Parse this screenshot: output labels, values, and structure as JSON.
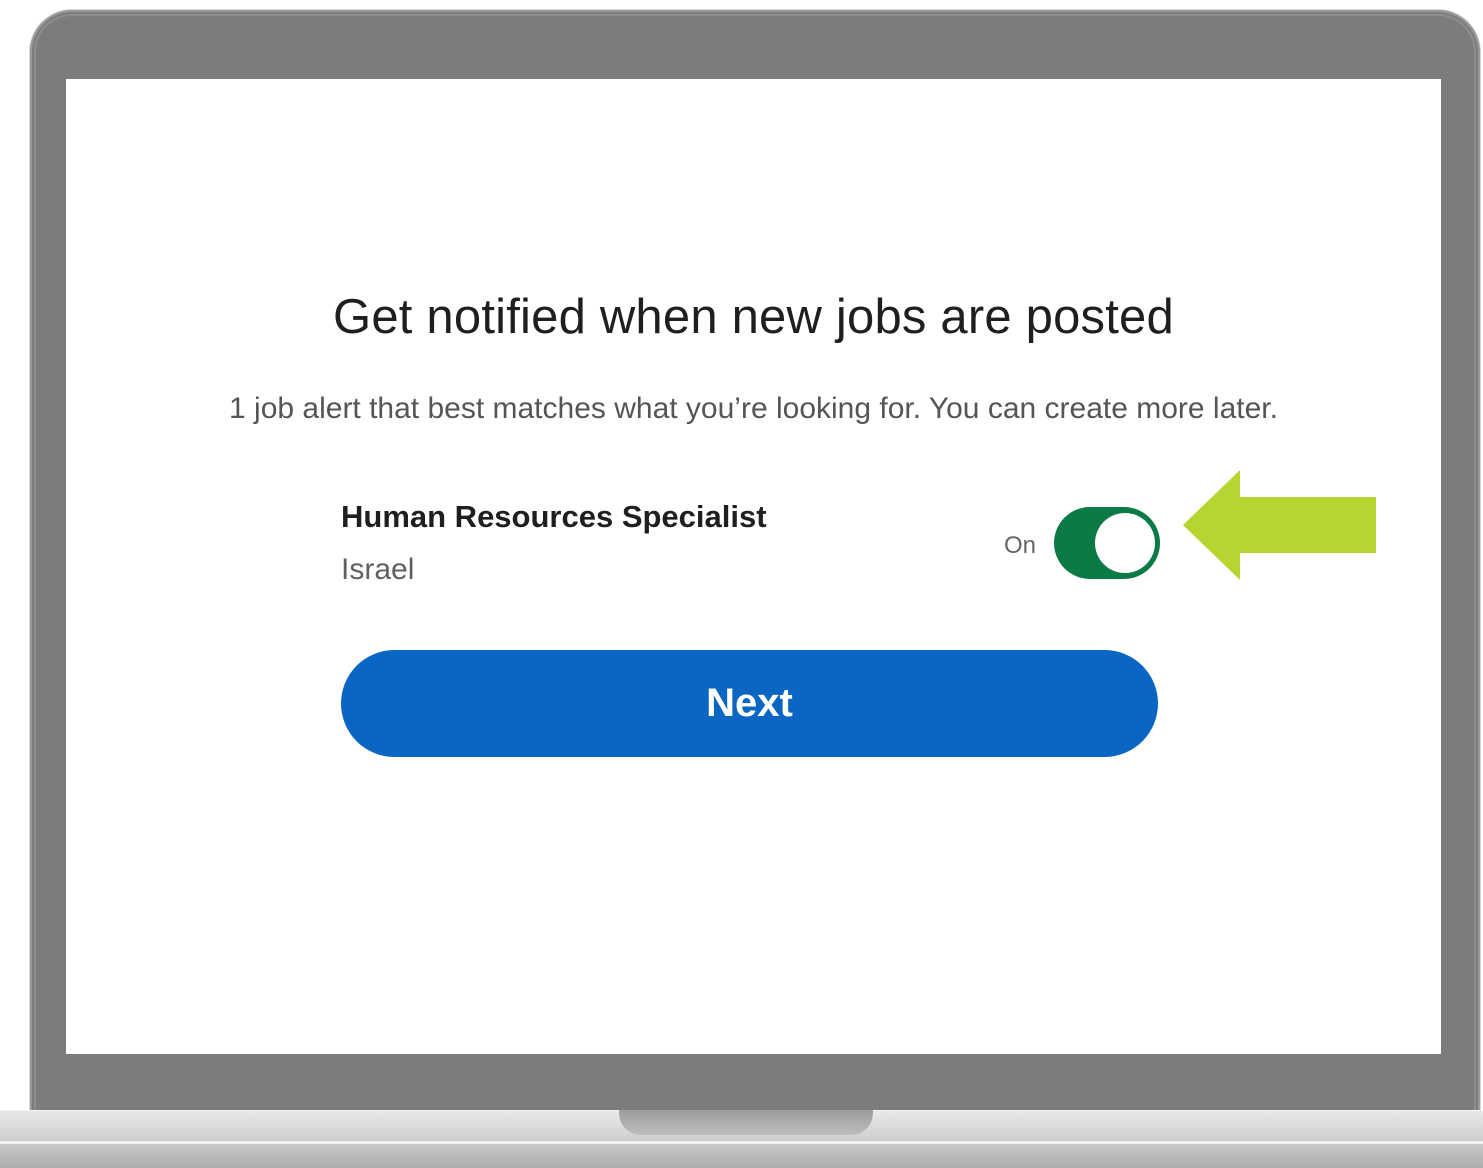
{
  "dialog": {
    "title": "Get notified when new jobs are posted",
    "subtitle": "1 job alert that best matches what you’re looking for. You can create more later."
  },
  "job_alert": {
    "job_title": "Human Resources Specialist",
    "location": "Israel",
    "toggle_label": "On",
    "toggle_state": true
  },
  "actions": {
    "next_label": "Next"
  },
  "colors": {
    "toggle_on": "#0b7a45",
    "primary_button": "#0a66c2",
    "annotation_arrow": "#b6d531",
    "bezel": "#7c7c7c"
  },
  "icons": {
    "annotation": "arrow-left-icon"
  }
}
